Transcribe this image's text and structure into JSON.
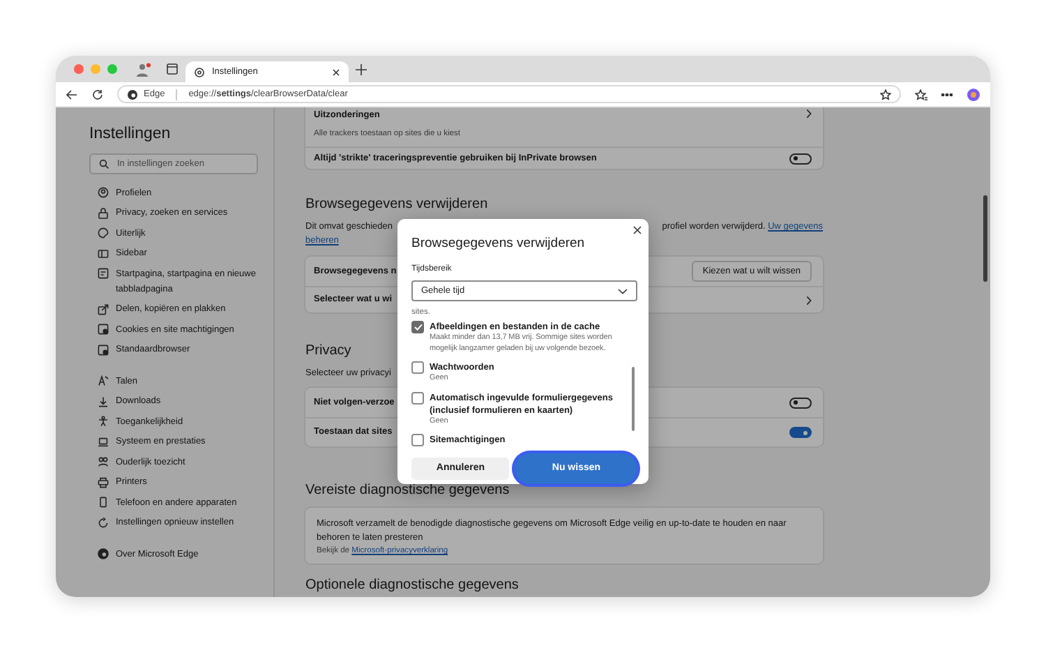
{
  "browser": {
    "tab": {
      "title": "Instellingen"
    },
    "address": {
      "brand": "Edge",
      "url": "edge://**settings**/clearBrowserData/clear"
    }
  },
  "sidebar": {
    "title": "Instellingen",
    "search": {
      "placeholder": "In instellingen zoeken"
    },
    "groups": [
      [
        "Profielen",
        "Privacy, zoeken en services",
        "Uiterlijk",
        "Sidebar",
        "Startpagina, startpagina en nieuwe tabbladpagina",
        "Delen, kopiëren en plakken",
        "Cookies en site machtigingen",
        "Standaardbrowser"
      ],
      [
        "Talen",
        "Downloads",
        "Toegankelijkheid",
        "Systeem en prestaties",
        "Ouderlijk toezicht",
        "Printers",
        "Telefoon en andere apparaten",
        "Instellingen opnieuw instellen"
      ],
      [
        "Over Microsoft Edge"
      ]
    ]
  },
  "main": {
    "top_card": {
      "rows": [
        {
          "kind": "link",
          "label": "Uitzonderingen",
          "description": "Alle trackers toestaan op sites die u kiest"
        },
        {
          "kind": "toggle",
          "label": "Altijd 'strikte' traceringspreventie gebruiken bij InPrivate browsen",
          "on": false
        }
      ]
    },
    "sections": [
      {
        "heading": "Browsegegevens verwijderen",
        "intro": {
          "left": "Dit omvat geschieden",
          "right": "profiel worden verwijderd.",
          "link": [
            "Uw gegevens",
            "beheren"
          ]
        },
        "rows": [
          {
            "kind": "button",
            "label": "Browsegegevens n",
            "button": "Kiezen wat u wilt wissen"
          },
          {
            "kind": "link",
            "label": "Selecteer wat u wi"
          }
        ]
      },
      {
        "heading": "Privacy",
        "intro": {
          "left": "Selecteer uw privacyi"
        },
        "rows": [
          {
            "kind": "toggle",
            "label": "Niet volgen-verzoe",
            "on": false
          },
          {
            "kind": "toggle",
            "label": "Toestaan dat sites",
            "on": true
          }
        ]
      },
      {
        "heading": "Vereiste diagnostische gegevens",
        "rows": [
          {
            "kind": "info",
            "label": "Microsoft verzamelt de benodigde diagnostische gegevens om Microsoft Edge veilig en up-to-date te houden en naar behoren te laten presteren",
            "note": "Bekijk de",
            "link": "Microsoft-privacyverklaring"
          }
        ]
      },
      {
        "heading": "Optionele diagnostische gegevens"
      }
    ]
  },
  "dialog": {
    "title": "Browsegegevens verwijderen",
    "range_label": "Tijdsbereik",
    "range_value": "Gehele tijd",
    "list_fragment": "sites.",
    "options": [
      {
        "label": "Afbeeldingen en bestanden in de cache",
        "description": "Maakt minder dan 13,7 MB vrij. Sommige sites worden mogelijk langzamer geladen bij uw volgende bezoek.",
        "checked": true
      },
      {
        "label": "Wachtwoorden",
        "description": "Geen",
        "checked": false
      },
      {
        "label": "Automatisch ingevulde formuliergegevens (inclusief formulieren en kaarten)",
        "description": "Geen",
        "checked": false
      },
      {
        "label": "Sitemachtigingen",
        "checked": false
      }
    ],
    "buttons": [
      {
        "label": "Annuleren",
        "kind": "secondary",
        "focused": false
      },
      {
        "label": "Nu wissen",
        "kind": "primary",
        "focused": true
      }
    ]
  }
}
